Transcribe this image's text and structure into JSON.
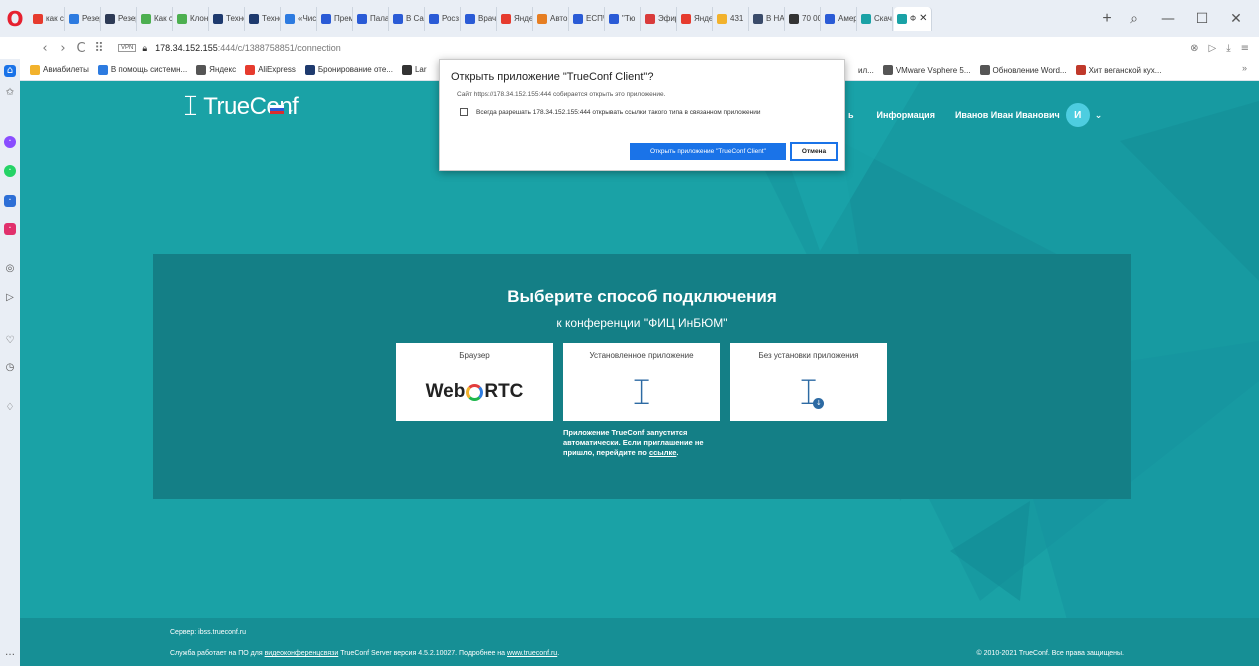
{
  "browser": {
    "tabs": [
      {
        "label": "как с",
        "color": "#e63b2e"
      },
      {
        "label": "Резер",
        "color": "#2d7be0"
      },
      {
        "label": "Резер",
        "color": "#2d3a55"
      },
      {
        "label": "Как с",
        "color": "#4caf50"
      },
      {
        "label": "Клон",
        "color": "#4caf50"
      },
      {
        "label": "Техно",
        "color": "#1e3a6e"
      },
      {
        "label": "Техно",
        "color": "#1e3a6e"
      },
      {
        "label": "«Чист",
        "color": "#2d7be0"
      },
      {
        "label": "Прем",
        "color": "#2a5bd6"
      },
      {
        "label": "Палат",
        "color": "#2a5bd6"
      },
      {
        "label": "В Сар",
        "color": "#2a5bd6"
      },
      {
        "label": "Росз",
        "color": "#2a5bd6"
      },
      {
        "label": "Врач",
        "color": "#2a5bd6"
      },
      {
        "label": "Яндек",
        "color": "#e63b2e"
      },
      {
        "label": "Авто",
        "color": "#e67e22"
      },
      {
        "label": "ЕСПЧ",
        "color": "#2a5bd6"
      },
      {
        "label": "\"Тю",
        "color": "#2a5bd6"
      },
      {
        "label": "Эфир",
        "color": "#d93b3b"
      },
      {
        "label": "Янде",
        "color": "#e63b2e"
      },
      {
        "label": "431",
        "color": "#f2b22c"
      },
      {
        "label": "В НА",
        "color": "#3a4b6a"
      },
      {
        "label": "70 00",
        "color": "#333"
      },
      {
        "label": "Амер",
        "color": "#2a5bd6"
      },
      {
        "label": "Скач",
        "color": "#1aa2a6"
      },
      {
        "label": "Ф",
        "color": "#1aa2a6"
      }
    ],
    "new_tab": "+",
    "url_host": "178.34.152.155",
    "url_path": ":444/c/1388758851/connection",
    "vpn": "VPN",
    "bookmarks": [
      {
        "label": "Авиабилеты",
        "color": "#f2b22c"
      },
      {
        "label": "В помощь системн...",
        "color": "#2d7be0"
      },
      {
        "label": "Яндекс",
        "color": "#555"
      },
      {
        "label": "AliExpress",
        "color": "#e63b2e"
      },
      {
        "label": "Бронирование оте...",
        "color": "#1e3a6e"
      },
      {
        "label": "Lar",
        "color": "#333"
      }
    ],
    "bookmarks_right": [
      {
        "label": "ил...",
        "color": "#ffffff"
      },
      {
        "label": "VMware Vsphere 5...",
        "color": "#555"
      },
      {
        "label": "Обновление Word...",
        "color": "#555"
      },
      {
        "label": "Хит веганской кух...",
        "color": "#c0392b"
      }
    ]
  },
  "header": {
    "logo_text": "TrueConf",
    "nav_help": "ь",
    "nav_info": "Информация",
    "user_name": "Иванов Иван Иванович",
    "avatar_initial": "И"
  },
  "main": {
    "title": "Выберите способ подключения",
    "subtitle": "к конференции \"ФИЦ ИнБЮМ\"",
    "cards": [
      {
        "label": "Браузер",
        "art": "WebRTC"
      },
      {
        "label": "Установленное приложение"
      },
      {
        "label": "Без установки приложения"
      }
    ],
    "webrtc_left": "Web",
    "webrtc_right": "RTC",
    "note_text": "Приложение TrueConf запустится автоматически. Если приглашение не пришло, перейдите по ",
    "note_link": "ссылке",
    "note_end": "."
  },
  "footer": {
    "server": "Сервер: ibss.trueconf.ru",
    "info_pre": "Служба работает на ПО для ",
    "info_link1": "видеоконференцсвязи",
    "info_mid": " TrueConf Server версия 4.5.2.10027. Подробнее на ",
    "info_link2": "www.trueconf.ru",
    "info_end": ".",
    "copyright": "© 2010-2021 TrueConf. Все права защищены."
  },
  "dialog": {
    "title": "Открыть приложение \"TrueConf Client\"?",
    "site_text": "Сайт https://178.34.152.155:444 собирается открыть это приложение.",
    "checkbox_label": "Всегда разрешать 178.34.152.155:444 открывать ссылки такого типа в связанном приложении",
    "open_label": "Открыть приложение \"TrueConf Client\"",
    "cancel_label": "Отмена"
  }
}
